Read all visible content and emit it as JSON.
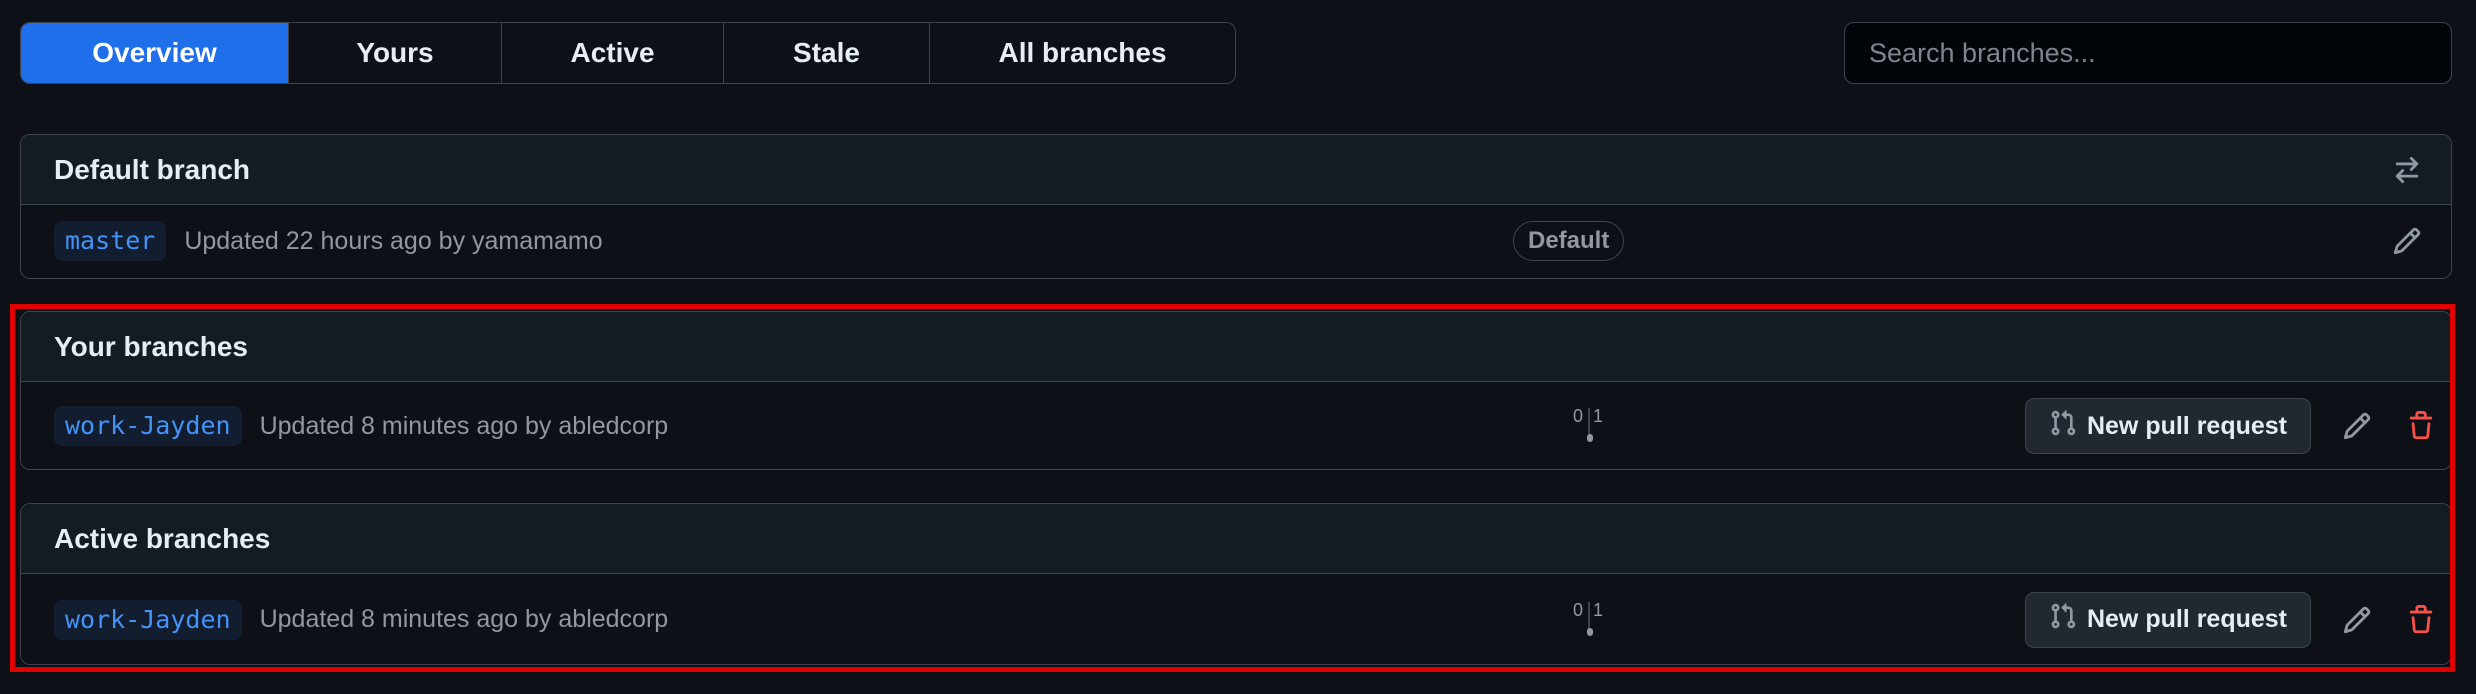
{
  "tabs": [
    {
      "label": "Overview",
      "selected": true
    },
    {
      "label": "Yours",
      "selected": false
    },
    {
      "label": "Active",
      "selected": false
    },
    {
      "label": "Stale",
      "selected": false
    },
    {
      "label": "All branches",
      "selected": false
    }
  ],
  "search": {
    "placeholder": "Search branches..."
  },
  "default_section": {
    "title": "Default branch",
    "header_icon": "arrow-switch-icon",
    "branch": {
      "name": "master",
      "meta": "Updated 22 hours ago by yamamamo",
      "badge": "Default"
    }
  },
  "your_section": {
    "title": "Your branches",
    "branch": {
      "name": "work-Jayden",
      "meta": "Updated 8 minutes ago by abledcorp",
      "behind": "0",
      "ahead": "1",
      "pr_label": "New pull request"
    }
  },
  "active_section": {
    "title": "Active branches",
    "branch": {
      "name": "work-Jayden",
      "meta": "Updated 8 minutes ago by abledcorp",
      "behind": "0",
      "ahead": "1",
      "pr_label": "New pull request"
    }
  },
  "colors": {
    "selected_tab": "#1f6feb",
    "branch_link": "#4493f8",
    "delete": "#f85149",
    "highlight": "#e00000"
  }
}
